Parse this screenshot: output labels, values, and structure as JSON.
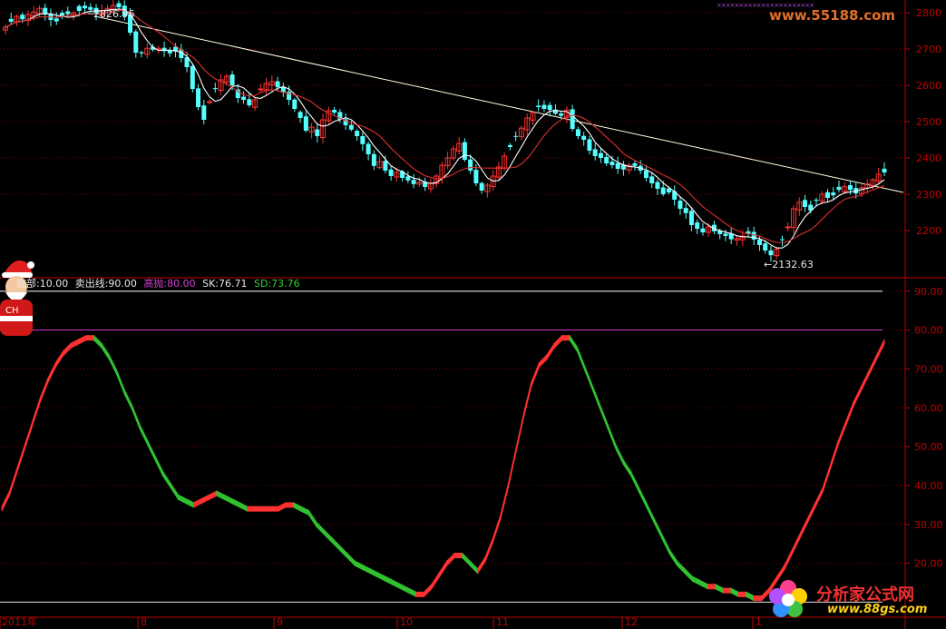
{
  "watermarks": {
    "top": "www.55188.com",
    "bottom_cn": "分析家公式网",
    "bottom_url": "www.88gs.com",
    "santa_text": "CH"
  },
  "legend": [
    {
      "label": "底部:10.00",
      "color": "#e6e6e6"
    },
    {
      "label": "卖出线:90.00",
      "color": "#e6e6e6"
    },
    {
      "label": "高抛:80.00",
      "color": "#d040d0"
    },
    {
      "label": "SK:76.71",
      "color": "#e6e6e6"
    },
    {
      "label": "SD:73.76",
      "color": "#30d030"
    }
  ],
  "colors": {
    "up": "#ff3232",
    "down": "#54ffff",
    "grid": "#7a0000",
    "axis": "#c00000",
    "ma_fast": "#ffffff",
    "ma_slow": "#e03030",
    "trend": "#ffffe0",
    "line90": "#ffffff",
    "line80": "#d040d0",
    "sk_up": "#ff3030",
    "sk_down": "#30c030"
  },
  "chart_data": [
    {
      "type": "candlestick",
      "title": "",
      "yaxis_ticks": [
        2200,
        2300,
        2400,
        2500,
        2600,
        2700,
        2800
      ],
      "ylim": [
        2100,
        2830
      ],
      "annotations": [
        {
          "text": "2826.96",
          "date": "2011-07-18",
          "value": 2826.96
        },
        {
          "text": "←2132.63",
          "date": "2012-01-06",
          "value": 2132.63
        }
      ],
      "trend_line": {
        "start": [
          "2011-06-28",
          2790
        ],
        "end": [
          "2012-01-20",
          2300
        ]
      },
      "closes": [
        2760,
        2775,
        2790,
        2782,
        2795,
        2802,
        2812,
        2795,
        2780,
        2776,
        2790,
        2796,
        2800,
        2805,
        2812,
        2808,
        2797,
        2806,
        2812,
        2820,
        2815,
        2790,
        2745,
        2690,
        2688,
        2702,
        2698,
        2702,
        2694,
        2688,
        2693,
        2675,
        2650,
        2590,
        2540,
        2505,
        2555,
        2590,
        2615,
        2625,
        2600,
        2565,
        2560,
        2545,
        2560,
        2590,
        2605,
        2610,
        2595,
        2580,
        2560,
        2535,
        2510,
        2475,
        2485,
        2460,
        2505,
        2530,
        2525,
        2505,
        2490,
        2478,
        2460,
        2438,
        2410,
        2378,
        2390,
        2365,
        2350,
        2360,
        2345,
        2338,
        2328,
        2333,
        2320,
        2330,
        2350,
        2380,
        2400,
        2425,
        2440,
        2395,
        2365,
        2330,
        2310,
        2325,
        2350,
        2375,
        2405,
        2430,
        2460,
        2482,
        2510,
        2525,
        2540,
        2535,
        2532,
        2522,
        2516,
        2532,
        2480,
        2460,
        2450,
        2420,
        2405,
        2400,
        2385,
        2380,
        2370,
        2368,
        2380,
        2378,
        2365,
        2345,
        2330,
        2315,
        2300,
        2305,
        2285,
        2260,
        2248,
        2215,
        2205,
        2195,
        2210,
        2198,
        2190,
        2185,
        2176,
        2178,
        2185,
        2190,
        2175,
        2160,
        2145,
        2132,
        2148,
        2175,
        2210,
        2260,
        2278,
        2265,
        2255,
        2282,
        2300,
        2290,
        2297,
        2312,
        2321,
        2312,
        2302,
        2318,
        2328,
        2340,
        2355,
        2360
      ]
    },
    {
      "type": "line",
      "title": "",
      "yaxis_ticks": [
        20,
        30,
        40,
        50,
        60,
        70,
        80,
        90
      ],
      "ylim": [
        8,
        93
      ],
      "xaxis_labels": [
        "2011年",
        "8",
        "9",
        "10",
        "11",
        "12",
        "1"
      ],
      "series": [
        {
          "name": "底部",
          "value": 10.0
        },
        {
          "name": "卖出线",
          "value": 90.0
        },
        {
          "name": "高抛",
          "value": 80.0
        },
        {
          "name": "SK",
          "last": 76.71,
          "values": [
            34,
            38,
            44,
            50,
            56,
            62,
            67,
            71,
            74,
            76,
            77,
            78,
            78,
            76,
            73,
            69,
            64,
            60,
            55,
            51,
            47,
            43,
            40,
            37,
            36,
            35,
            36,
            37,
            38,
            37,
            36,
            35,
            34,
            34,
            34,
            34,
            34,
            35,
            35,
            34,
            33,
            30,
            28,
            26,
            24,
            22,
            20,
            19,
            18,
            17,
            16,
            15,
            14,
            13,
            12,
            12,
            14,
            17,
            20,
            22,
            22,
            20,
            18,
            21,
            26,
            32,
            40,
            49,
            58,
            66,
            71,
            73,
            76,
            78,
            78,
            75,
            70,
            65,
            60,
            55,
            50,
            46,
            43,
            39,
            35,
            31,
            27,
            23,
            20,
            18,
            16,
            15,
            14,
            14,
            13,
            13,
            12,
            12,
            11,
            11,
            13,
            16,
            19,
            23,
            27,
            31,
            35,
            39,
            45,
            51,
            56,
            61,
            65,
            69,
            73,
            77
          ]
        },
        {
          "name": "SD",
          "last": 73.76
        }
      ]
    }
  ]
}
